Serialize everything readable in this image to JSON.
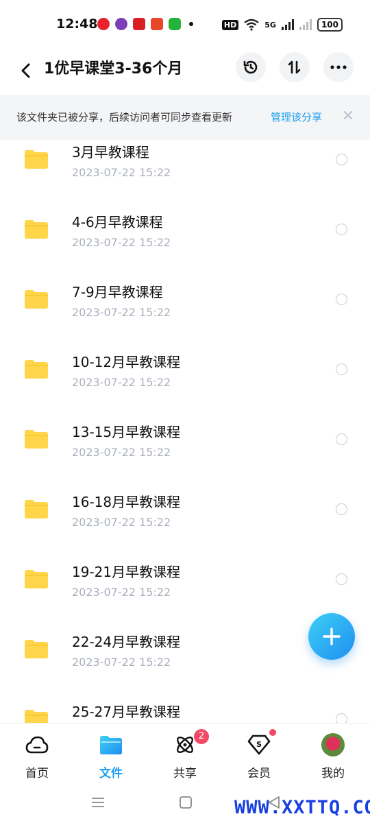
{
  "status_bar": {
    "time": "12:48",
    "hd": "HD",
    "network": "5G",
    "battery": "100"
  },
  "header": {
    "title": "1优早课堂3-36个月"
  },
  "banner": {
    "text": "该文件夹已被分享，后续访问者可同步查看更新",
    "link": "管理该分享"
  },
  "files": [
    {
      "name": "3月早教课程",
      "date": "2023-07-22  15:22"
    },
    {
      "name": "4-6月早教课程",
      "date": "2023-07-22  15:22"
    },
    {
      "name": "7-9月早教课程",
      "date": "2023-07-22  15:22"
    },
    {
      "name": "10-12月早教课程",
      "date": "2023-07-22  15:22"
    },
    {
      "name": "13-15月早教课程",
      "date": "2023-07-22  15:22"
    },
    {
      "name": "16-18月早教课程",
      "date": "2023-07-22  15:22"
    },
    {
      "name": "19-21月早教课程",
      "date": "2023-07-22  15:22"
    },
    {
      "name": "22-24月早教课程",
      "date": "2023-07-22  15:22"
    },
    {
      "name": "25-27月早教课程",
      "date": ""
    }
  ],
  "bottom_nav": [
    {
      "label": "首页",
      "icon": "cloud-icon"
    },
    {
      "label": "文件",
      "icon": "folder-icon",
      "active": true
    },
    {
      "label": "共享",
      "icon": "atom-icon",
      "badge": "2"
    },
    {
      "label": "会员",
      "icon": "diamond-icon"
    },
    {
      "label": "我的",
      "icon": "avatar"
    }
  ],
  "colors": {
    "accent": "#1a9ef0",
    "folder": "#ffd54a",
    "badge": "#f24965"
  },
  "watermark": "WWW.XXTTQ.COM"
}
